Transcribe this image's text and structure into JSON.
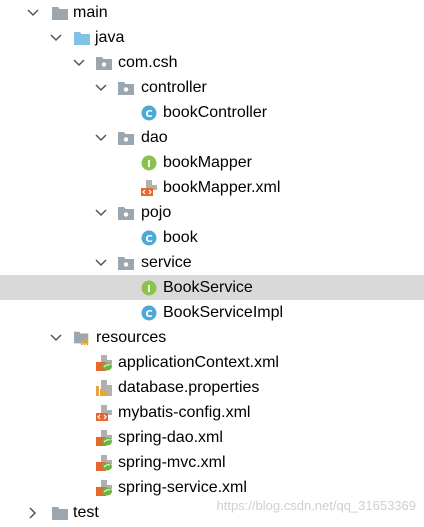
{
  "tree": {
    "items": [
      {
        "label": "main",
        "icon": "folder-icon",
        "expanded": true
      },
      {
        "label": "java",
        "icon": "source-folder-icon",
        "expanded": true
      },
      {
        "label": "com.csh",
        "icon": "package-icon",
        "expanded": true
      },
      {
        "label": "controller",
        "icon": "package-icon",
        "expanded": true
      },
      {
        "label": "bookController",
        "icon": "class-icon"
      },
      {
        "label": "dao",
        "icon": "package-icon",
        "expanded": true
      },
      {
        "label": "bookMapper",
        "icon": "interface-icon"
      },
      {
        "label": "bookMapper.xml",
        "icon": "xml-file-icon"
      },
      {
        "label": "pojo",
        "icon": "package-icon",
        "expanded": true
      },
      {
        "label": "book",
        "icon": "class-icon"
      },
      {
        "label": "service",
        "icon": "package-icon",
        "expanded": true
      },
      {
        "label": "BookService",
        "icon": "interface-icon",
        "selected": true
      },
      {
        "label": "BookServiceImpl",
        "icon": "class-icon"
      },
      {
        "label": "resources",
        "icon": "resources-folder-icon",
        "expanded": true
      },
      {
        "label": "applicationContext.xml",
        "icon": "spring-xml-icon"
      },
      {
        "label": "database.properties",
        "icon": "properties-file-icon"
      },
      {
        "label": "mybatis-config.xml",
        "icon": "xml-file-icon"
      },
      {
        "label": "spring-dao.xml",
        "icon": "spring-xml-icon"
      },
      {
        "label": "spring-mvc.xml",
        "icon": "spring-xml-icon"
      },
      {
        "label": "spring-service.xml",
        "icon": "spring-xml-icon"
      },
      {
        "label": "test",
        "icon": "folder-icon",
        "expanded": false
      }
    ]
  },
  "watermark": "https://blog.csdn.net/qq_31653369",
  "colors": {
    "selection": "#d9d9d9",
    "folder": "#9aa7b0",
    "source_folder": "#7fc3e6",
    "class_icon": "#4da9d6",
    "interface_icon": "#8bc34a",
    "spring_green": "#6db33f",
    "xml_orange": "#e8672d"
  }
}
